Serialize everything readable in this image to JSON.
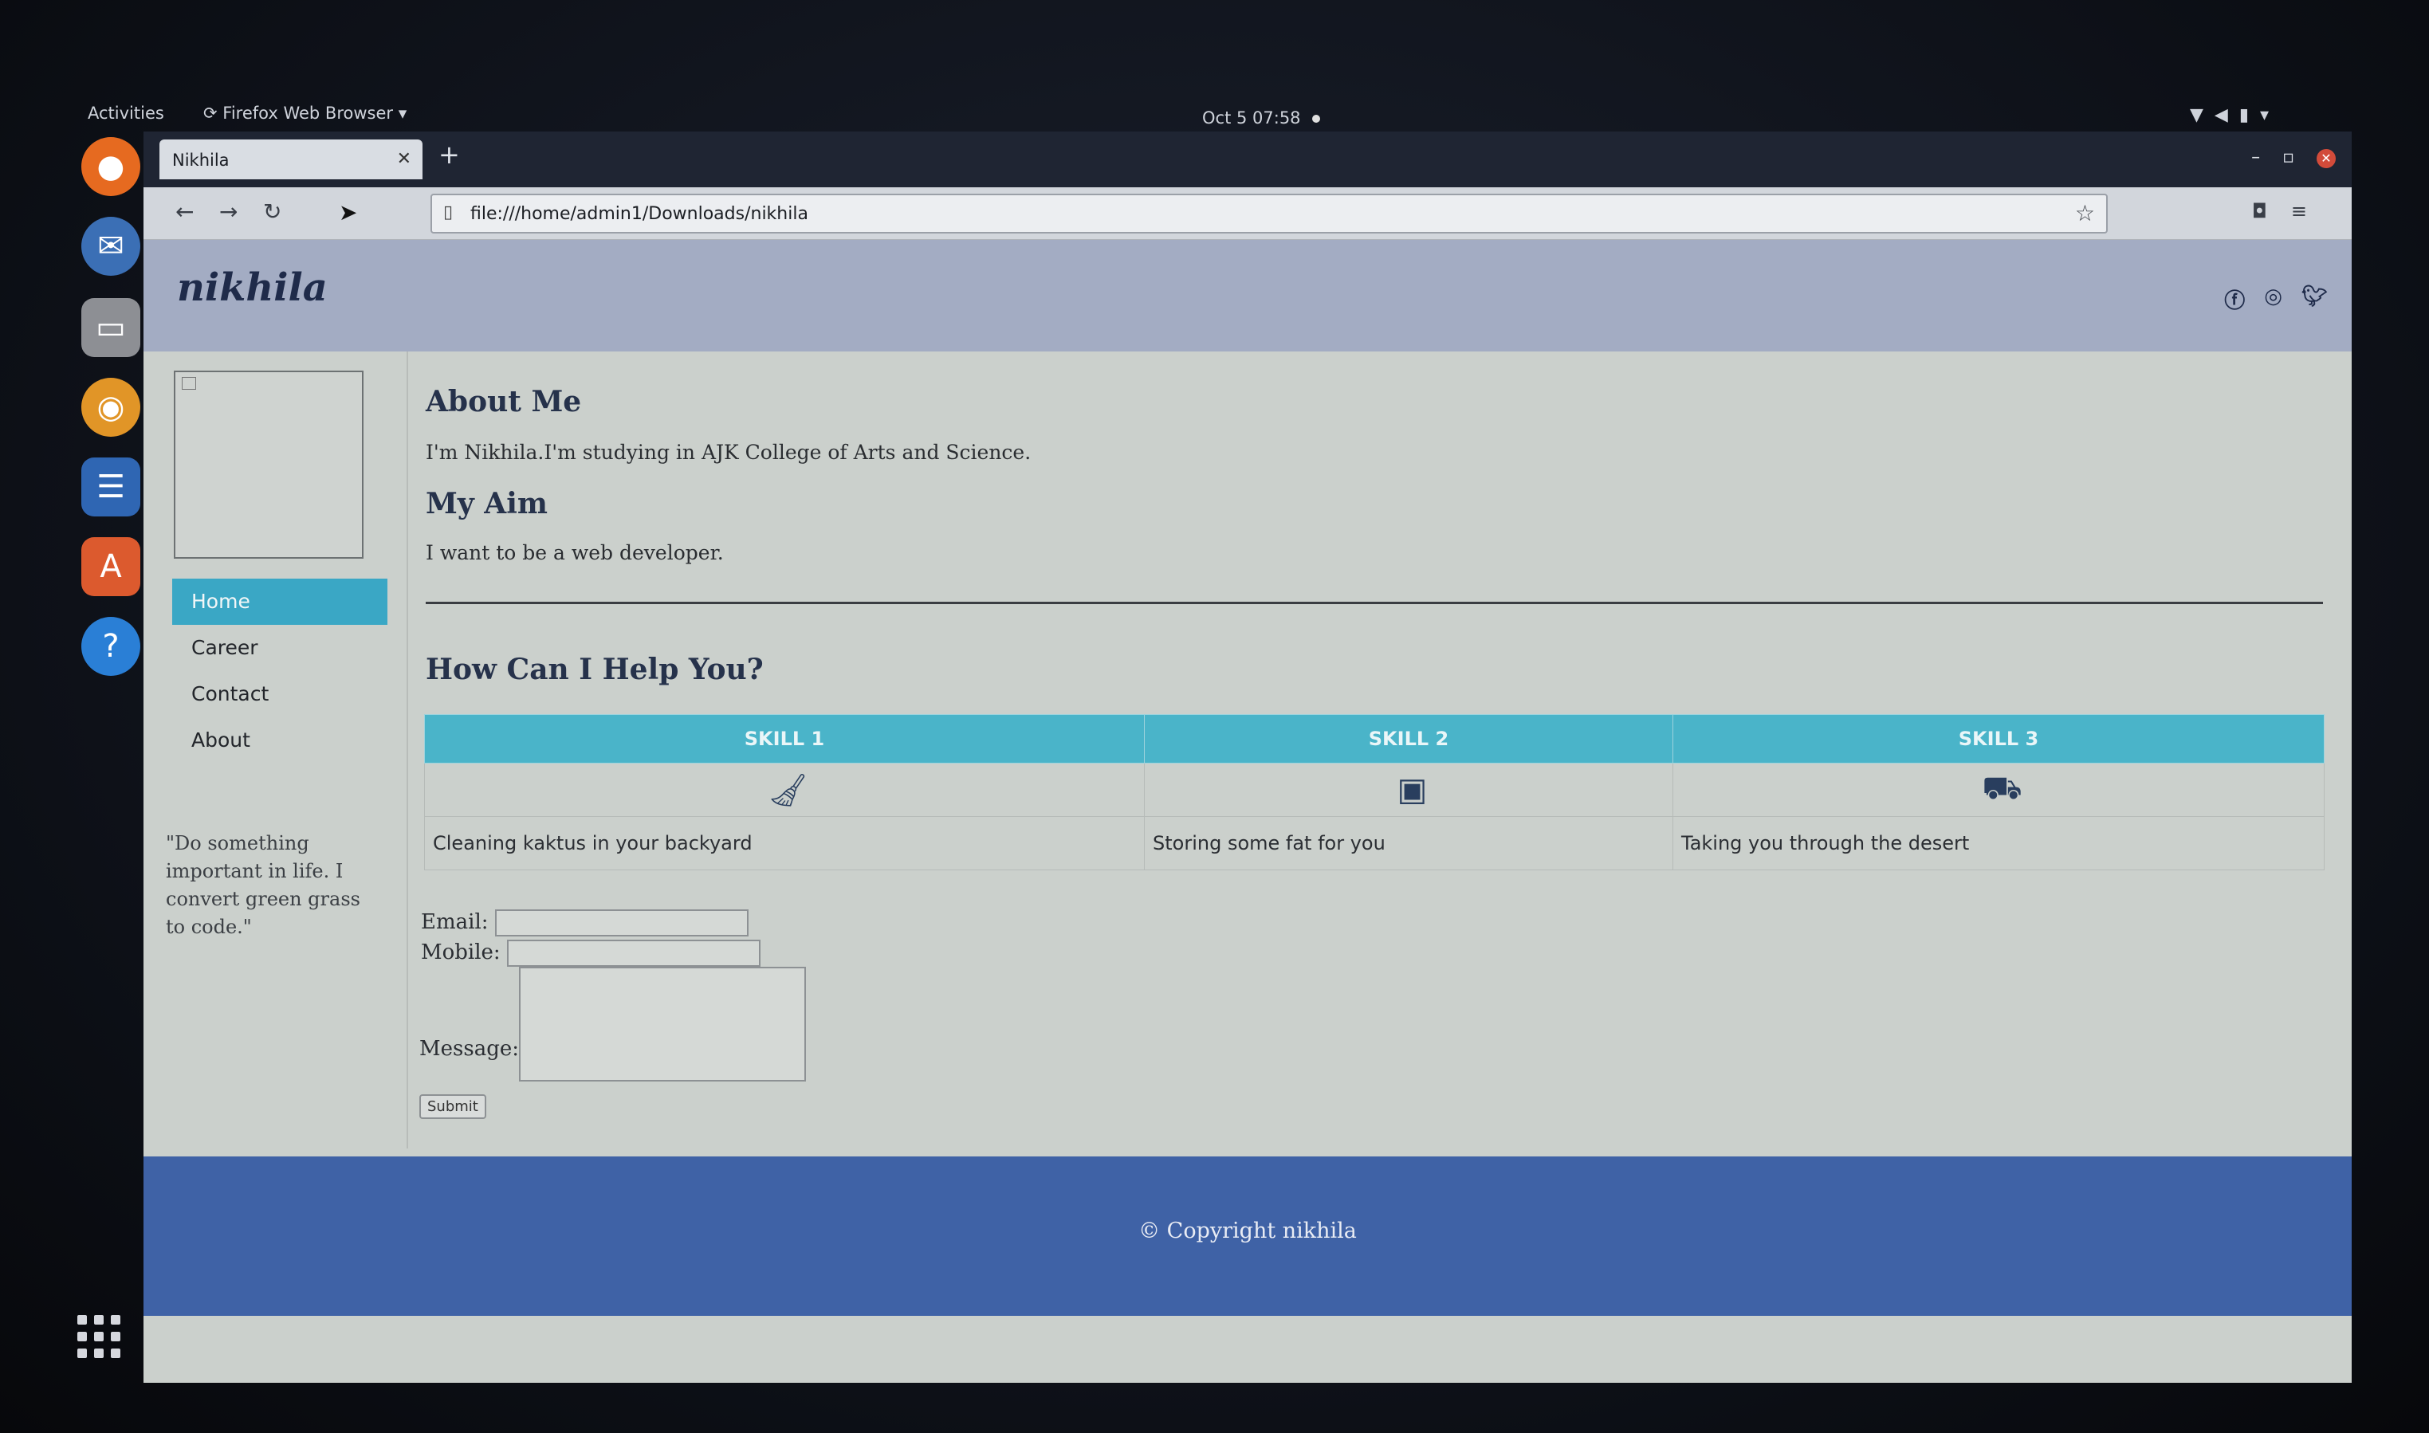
{
  "system": {
    "activities": "Activities",
    "app_menu": "Firefox Web Browser",
    "clock": "Oct 5  07:58"
  },
  "browser": {
    "tab_title": "Nikhila",
    "url": "file:///home/admin1/Downloads/nikhila"
  },
  "site": {
    "logo": "nikhila",
    "nav": [
      "Home",
      "Career",
      "Contact",
      "About"
    ],
    "active_nav": "Home",
    "quote": "\"Do something important in life. I convert green grass to code.\"",
    "about_heading": "About Me",
    "about_text": "I'm Nikhila.I'm studying in AJK College of Arts and Science.",
    "aim_heading": "My Aim",
    "aim_text": "I want to be a web developer.",
    "help_heading": "How Can I Help You?",
    "skills": [
      {
        "title": "SKILL 1",
        "icon": "broom-icon",
        "desc": "Cleaning kaktus in your backyard"
      },
      {
        "title": "SKILL 2",
        "icon": "archive-icon",
        "desc": "Storing some fat for you"
      },
      {
        "title": "SKILL 3",
        "icon": "trailer-icon",
        "desc": "Taking you through the desert"
      }
    ],
    "form": {
      "email_label": "Email:",
      "mobile_label": "Mobile:",
      "message_label": "Message:",
      "submit_label": "Submit"
    },
    "footer": "© Copyright nikhila"
  },
  "colors": {
    "header_bg": "#a3acc3",
    "accent": "#4ab4c9",
    "footer_bg": "#3f62a6"
  }
}
